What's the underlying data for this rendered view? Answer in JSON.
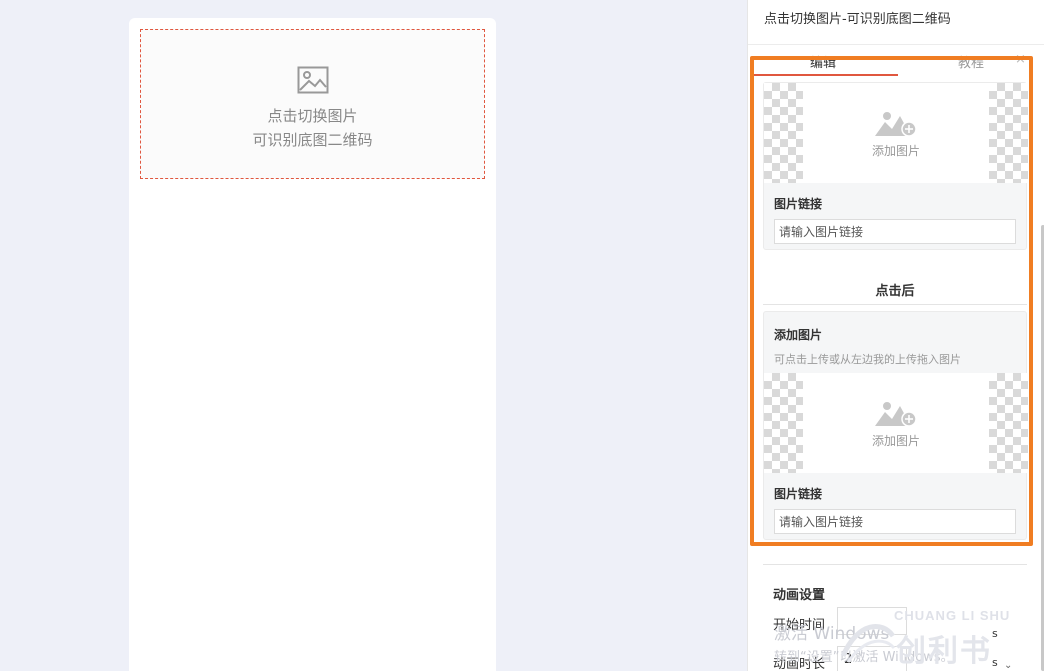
{
  "canvas": {
    "preview_line1": "点击切换图片",
    "preview_line2": "可识别底图二维码"
  },
  "panel": {
    "title": "点击切换图片-可识别底图二维码",
    "tabs": [
      {
        "label": "编辑",
        "active": true
      },
      {
        "label": "教程",
        "active": false
      }
    ],
    "close_icon": "×",
    "card1": {
      "upload_label": "添加图片",
      "link_label": "图片链接",
      "link_placeholder": "请输入图片链接"
    },
    "after_click_title": "点击后",
    "card2": {
      "title": "添加图片",
      "hint": "可点击上传或从左边我的上传拖入图片",
      "upload_label": "添加图片",
      "link_label": "图片链接",
      "link_placeholder": "请输入图片链接"
    },
    "animation": {
      "title": "动画设置",
      "start_label": "开始时间",
      "duration_label": "动画时长",
      "duration_value": "2",
      "unit": "s"
    }
  },
  "watermark": {
    "line1": "激活 Windows",
    "line2": "转到“设置”以激活 Windows。"
  },
  "logo": {
    "en": "CHUANG LI SHU",
    "cn": "创利书"
  },
  "colors": {
    "accent": "#e0573f",
    "highlight": "#f07d22",
    "background": "#eef0f8"
  },
  "icons": [
    "image-icon",
    "add-image-icon",
    "close-icon",
    "chevron-down-icon"
  ]
}
